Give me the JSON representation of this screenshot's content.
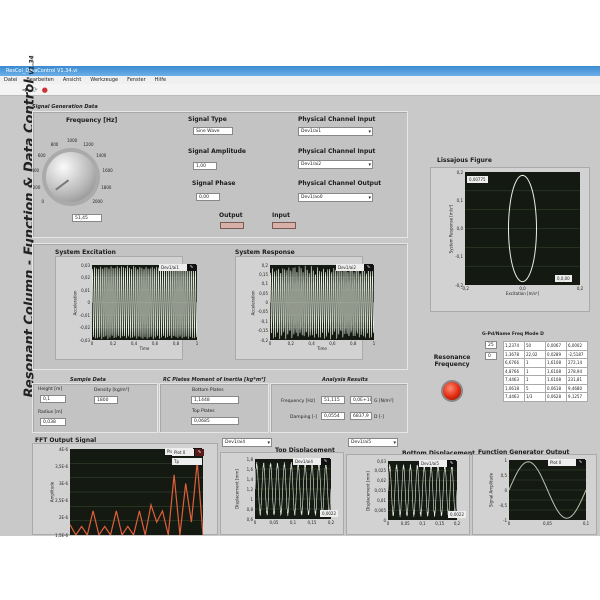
{
  "window": {
    "title": "ResCol_DataControl V1.34.vi",
    "menu": [
      "Datei",
      "Bearbeiten",
      "Ansicht",
      "Werkzeuge",
      "Fenster",
      "Hilfe"
    ]
  },
  "side_title": "Resonant Column - Function & Data Control",
  "version": "V1.34",
  "signal_gen": {
    "section": "Signal Generation Data",
    "freq_label": "Frequency [Hz]",
    "knob_ticks": [
      "0",
      "200",
      "400",
      "600",
      "800",
      "1000",
      "1200",
      "1400",
      "1600",
      "1800",
      "2000"
    ],
    "knob_value_fraction": 0.03,
    "freq_value": "51,45",
    "type_label": "Signal Type",
    "type_value": "Sine Wave",
    "amp_label": "Signal Amplitude",
    "amp_value": "1,00",
    "phase_label": "Signal Phase",
    "phase_value": "0,00",
    "ch_in1_label": "Physical Channel Input",
    "ch_in1": "Dev1/ai1",
    "ch_in2_label": "Physical Channel Input",
    "ch_in2": "Dev1/ai2",
    "ch_out_label": "Physical Channel Output",
    "ch_out": "Dev1/ao0",
    "output_label": "Output",
    "input_label": "Input"
  },
  "excitation": {
    "title": "System Excitation",
    "legend": "Dev1/ai1",
    "ylabel": "Acceleration",
    "xlabel": "Time",
    "yticks": [
      "0,03",
      "0,02",
      "0,01",
      "0",
      "-0,01",
      "-0,02",
      "-0,03"
    ],
    "xticks": [
      "0",
      "0,2",
      "0,4",
      "0,6",
      "0,8",
      "1"
    ]
  },
  "response": {
    "title": "System Response",
    "legend": "Dev1/ai2",
    "ylabel": "Acceleration",
    "xlabel": "Time",
    "yticks": [
      "0,2",
      "0,15",
      "0,1",
      "0,05",
      "0",
      "-0,05",
      "-0,1",
      "-0,15",
      "-0,2"
    ],
    "xticks": [
      "0",
      "0,2",
      "0,4",
      "0,6",
      "0,8",
      "1"
    ]
  },
  "lissajous": {
    "title": "Lissajous Figure",
    "ylabel": "System Response [m/s²]",
    "xlabel": "Excitation [m/s²]",
    "yticks": [
      "0,2",
      "0,1",
      "0,0",
      "-0,1",
      "-0,2"
    ],
    "xticks": [
      "-0,2",
      "0,0",
      "0,2"
    ],
    "cursor1": "0,00775",
    "cursor2": "0,0,00"
  },
  "sample": {
    "section": "Sample Data",
    "height_label": "Height [m]",
    "height": "0,1",
    "density_label": "Density [kg/m³]",
    "density": "1800",
    "radius_label": "Radius [m]",
    "radius": "0,038"
  },
  "rc": {
    "section": "RC Plates Moment of Inertia [kg*m²]",
    "bottom_label": "Bottom Plates",
    "bottom": "1,1448",
    "top_label": "Top Plates",
    "top": "0,0685"
  },
  "analysis": {
    "section": "Analysis Results",
    "freq_label": "Frequency [Hz]",
    "freq": "51,115",
    "freq2": "0,0E+10",
    "freq_unit": "G [N/m²]",
    "damp_label": "Damping [-]",
    "damp": "0,0554",
    "damp2": "6837,9",
    "damp_unit": "D [-]"
  },
  "resonance": {
    "label1": "Resonance",
    "label2": "Frequency",
    "led_color": "#e02a10"
  },
  "table": {
    "title": "G-Pd/Name Freq Mode D",
    "index1": "25",
    "index2": "0",
    "rows": [
      [
        "1,2374",
        "50",
        "0,0067",
        "6,0002"
      ],
      [
        "1,3678",
        "22,02",
        "0,0289",
        "-2,5187"
      ],
      [
        "6,6766",
        "1",
        "1,6108",
        "272,14"
      ],
      [
        "4,8766",
        "1",
        "1,6108",
        "278,94"
      ],
      [
        "7,4463",
        "1",
        "1,6108",
        "231,81"
      ],
      [
        "1,0618",
        "5",
        "0,0618",
        "9,4680"
      ],
      [
        "7,4463",
        "1/3",
        "0,0628",
        "9,1257"
      ]
    ]
  },
  "fft": {
    "title": "FFT Output Signal",
    "legend": "Plot 0",
    "legend2": "Tp",
    "ylabel": "Amplitude",
    "yticks": [
      "4E-6",
      "3,5E-6",
      "3E-6",
      "2,5E-6",
      "2E-6",
      "1,5E-6"
    ]
  },
  "top_disp": {
    "channel": "Dev1/ai4",
    "title": "Top Displacement",
    "legend": "Dev1/ai4",
    "ylabel": "Displacement [mm]",
    "yticks": [
      "1,8",
      "1,6",
      "1,4",
      "1,2",
      "1",
      "0,8",
      "0,6"
    ],
    "xticks": [
      "0",
      "0,05",
      "0,1",
      "0,15",
      "0,2"
    ],
    "cursor": "0,0022"
  },
  "bot_disp": {
    "channel": "Dev1/ai5",
    "title": "Bottom Displacement",
    "legend": "Dev1/ai5",
    "ylabel": "Displacement [mm]",
    "yticks": [
      "0,03",
      "0,025",
      "0,02",
      "0,015",
      "0,01",
      "0,005",
      "0"
    ],
    "xticks": [
      "0",
      "0,05",
      "0,1",
      "0,15",
      "0,2"
    ],
    "cursor": "0,0022"
  },
  "funcgen": {
    "title": "Function Generator Output",
    "legend": "Plot 0",
    "ylabel": "Signal Amplitude",
    "yticks": [
      "1",
      "0,5",
      "0",
      "-0,5",
      "-1"
    ],
    "xticks": [
      "0",
      "0,05",
      "0,1"
    ]
  }
}
